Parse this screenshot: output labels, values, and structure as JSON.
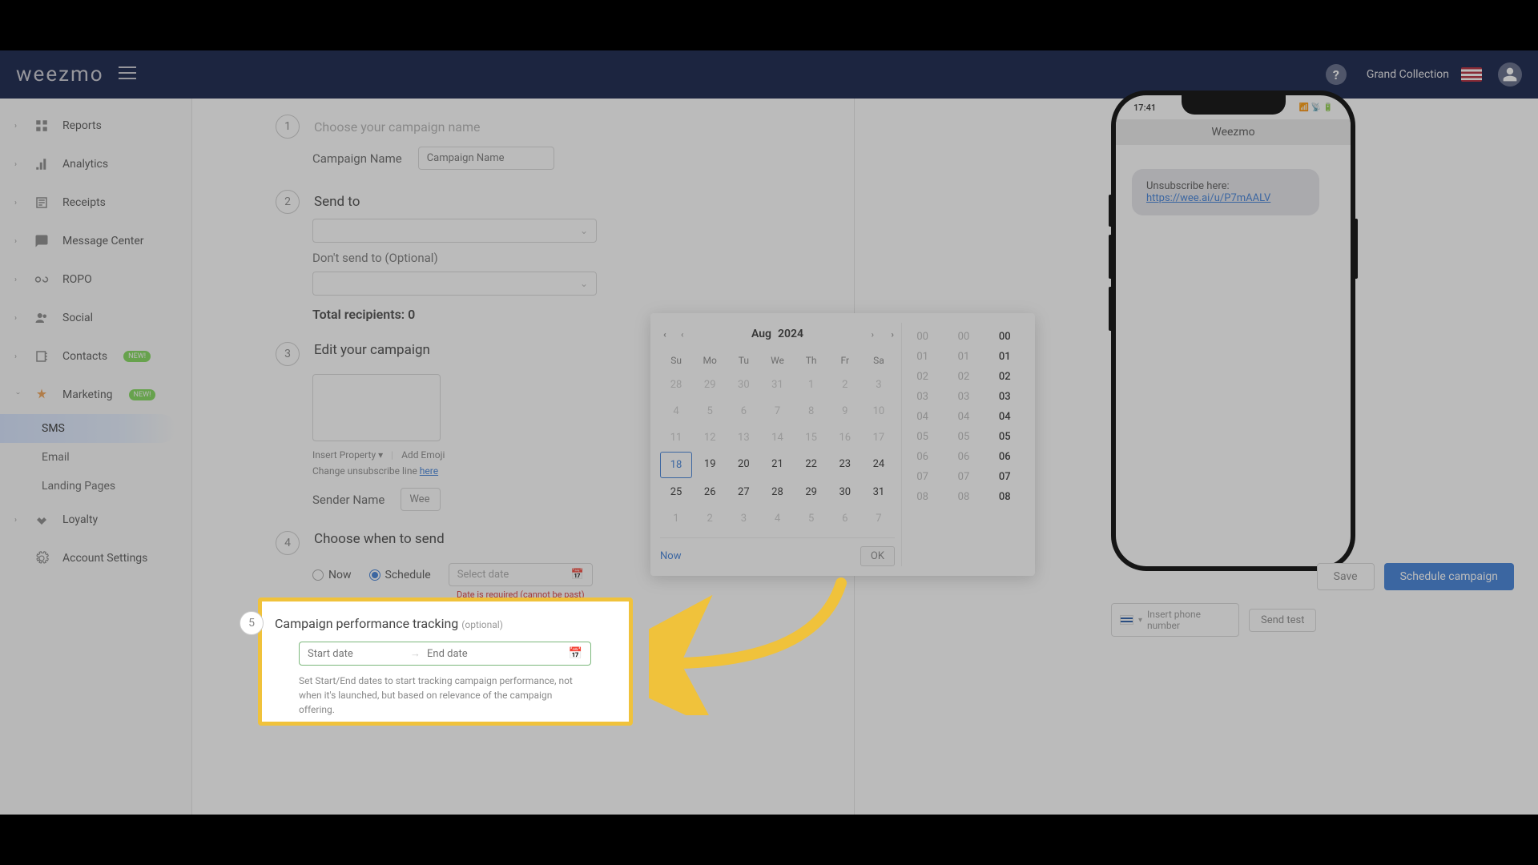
{
  "brand": "weezmo",
  "topbar": {
    "account": "Grand Collection"
  },
  "sidebar": {
    "items": [
      {
        "label": "Reports"
      },
      {
        "label": "Analytics"
      },
      {
        "label": "Receipts"
      },
      {
        "label": "Message Center"
      },
      {
        "label": "ROPO"
      },
      {
        "label": "Social"
      },
      {
        "label": "Contacts",
        "badge": "NEW!"
      },
      {
        "label": "Marketing",
        "badge": "NEW!"
      },
      {
        "label": "Loyalty"
      },
      {
        "label": "Account Settings"
      }
    ],
    "marketing_sub": [
      {
        "label": "SMS",
        "active": true
      },
      {
        "label": "Email"
      },
      {
        "label": "Landing Pages"
      }
    ]
  },
  "steps": {
    "s1": {
      "num": "1",
      "title": "Choose your campaign name",
      "campaign_label": "Campaign Name",
      "campaign_ph": "Campaign Name"
    },
    "s2": {
      "num": "2",
      "title": "Send to",
      "dont_send": "Don't send to (Optional)",
      "total_label": "Total recipients: 0"
    },
    "s3": {
      "num": "3",
      "title": "Edit your campaign",
      "insert_prop": "Insert Property",
      "add_emoji": "Add Emoji",
      "unsub_line": "Change unsubscribe line ",
      "unsub_link": "here",
      "sender_label": "Sender Name",
      "sender_value": "Wee"
    },
    "s4": {
      "num": "4",
      "title": "Choose when to send",
      "now": "Now",
      "schedule": "Schedule",
      "select_date": "Select date",
      "error": "Date is required (cannot be past)"
    },
    "s5": {
      "num": "5",
      "title": "Campaign performance tracking",
      "optional": "(optional)",
      "start_ph": "Start date",
      "end_ph": "End date",
      "helper": "Set Start/End dates to start tracking campaign performance, not when it's launched, but based on relevance of the campaign offering."
    }
  },
  "datepicker": {
    "month": "Aug",
    "year": "2024",
    "dow": [
      "Su",
      "Mo",
      "Tu",
      "We",
      "Th",
      "Fr",
      "Sa"
    ],
    "weeks": [
      [
        {
          "d": "28",
          "o": true
        },
        {
          "d": "29",
          "o": true
        },
        {
          "d": "30",
          "o": true
        },
        {
          "d": "31",
          "o": true
        },
        {
          "d": "1",
          "dis": true
        },
        {
          "d": "2",
          "dis": true
        },
        {
          "d": "3",
          "dis": true
        }
      ],
      [
        {
          "d": "4",
          "dis": true
        },
        {
          "d": "5",
          "dis": true
        },
        {
          "d": "6",
          "dis": true
        },
        {
          "d": "7",
          "dis": true
        },
        {
          "d": "8",
          "dis": true
        },
        {
          "d": "9",
          "dis": true
        },
        {
          "d": "10",
          "dis": true
        }
      ],
      [
        {
          "d": "11",
          "dis": true
        },
        {
          "d": "12",
          "dis": true
        },
        {
          "d": "13",
          "dis": true
        },
        {
          "d": "14",
          "dis": true
        },
        {
          "d": "15",
          "dis": true
        },
        {
          "d": "16",
          "dis": true
        },
        {
          "d": "17",
          "dis": true
        }
      ],
      [
        {
          "d": "18",
          "today": true
        },
        {
          "d": "19"
        },
        {
          "d": "20"
        },
        {
          "d": "21"
        },
        {
          "d": "22"
        },
        {
          "d": "23"
        },
        {
          "d": "24"
        }
      ],
      [
        {
          "d": "25"
        },
        {
          "d": "26"
        },
        {
          "d": "27"
        },
        {
          "d": "28"
        },
        {
          "d": "29"
        },
        {
          "d": "30"
        },
        {
          "d": "31"
        }
      ],
      [
        {
          "d": "1",
          "o": true
        },
        {
          "d": "2",
          "o": true
        },
        {
          "d": "3",
          "o": true
        },
        {
          "d": "4",
          "o": true
        },
        {
          "d": "5",
          "o": true
        },
        {
          "d": "6",
          "o": true
        },
        {
          "d": "7",
          "o": true
        }
      ]
    ],
    "now": "Now",
    "ok": "OK",
    "time": {
      "cols": [
        [
          "00",
          "01",
          "02",
          "03",
          "04",
          "05",
          "06",
          "07",
          "08"
        ],
        [
          "00",
          "01",
          "02",
          "03",
          "04",
          "05",
          "06",
          "07",
          "08"
        ],
        [
          "00",
          "01",
          "02",
          "03",
          "04",
          "05",
          "06",
          "07",
          "08"
        ]
      ]
    }
  },
  "preview": {
    "time": "17:41",
    "title": "Weezmo",
    "unsub_text": "Unsubscribe here:",
    "unsub_url": "https://wee.ai/u/P7mAALV",
    "phone_ph": "Insert phone number",
    "send_test": "Send test"
  },
  "actions": {
    "save": "Save",
    "schedule": "Schedule campaign"
  }
}
